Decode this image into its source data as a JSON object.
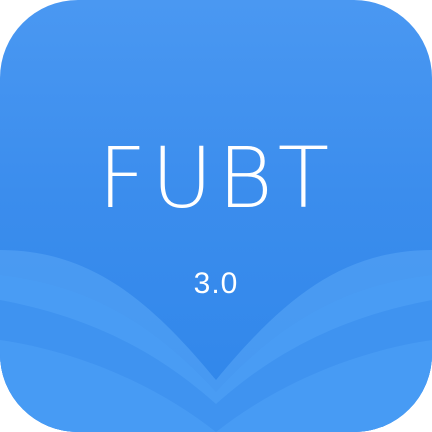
{
  "icon": {
    "title": "FUBT",
    "version": "3.0",
    "colors": {
      "background_top": "#4a98f2",
      "background_bottom": "#2f86ea",
      "wave_light": "#5aa7f7",
      "wave_mid": "#3f93f0",
      "wave_dark": "#2a7fe4",
      "text": "#ffffff"
    }
  }
}
